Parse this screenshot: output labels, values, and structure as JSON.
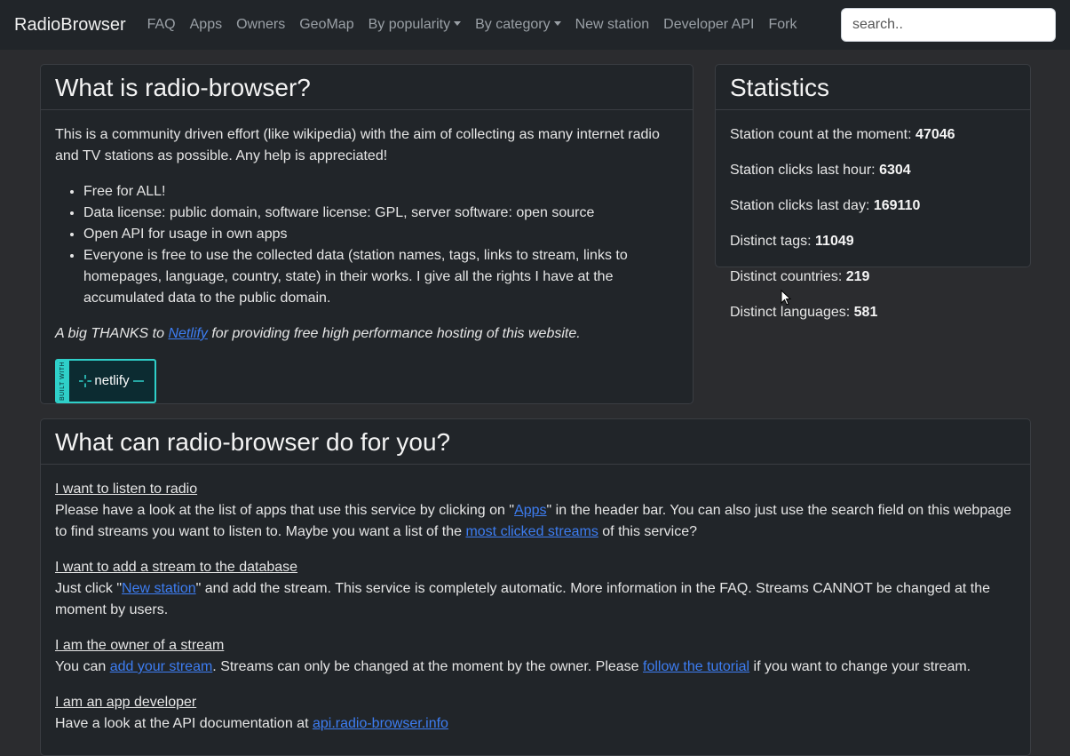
{
  "navbar": {
    "brand": "RadioBrowser",
    "items": [
      "FAQ",
      "Apps",
      "Owners",
      "GeoMap"
    ],
    "dropdowns": [
      "By popularity",
      "By category"
    ],
    "links": [
      "New station",
      "Developer API",
      "Fork"
    ],
    "search_placeholder": "search.."
  },
  "about": {
    "title": "What is radio-browser?",
    "intro": "This is a community driven effort (like wikipedia) with the aim of collecting as many internet radio and TV stations as possible. Any help is appreciated!",
    "features": [
      "Free for ALL!",
      "Data license: public domain, software license: GPL, server software: open source",
      "Open API for usage in own apps",
      "Everyone is free to use the collected data (station names, tags, links to stream, links to homepages, language, country, state) in their works. I give all the rights I have at the accumulated data to the public domain."
    ],
    "thanks_before": "A big THANKS to ",
    "thanks_link": "Netlify",
    "thanks_after": " for providing free high performance hosting of this website.",
    "badge_side": "BUILT WITH",
    "badge_text": "netlify"
  },
  "stats": {
    "title": "Statistics",
    "items": [
      {
        "label": "Station count at the moment: ",
        "value": "47046"
      },
      {
        "label": "Station clicks last hour: ",
        "value": "6304"
      },
      {
        "label": "Station clicks last day: ",
        "value": "169110"
      },
      {
        "label": "Distinct tags: ",
        "value": "11049"
      },
      {
        "label": "Distinct countries: ",
        "value": "219"
      },
      {
        "label": "Distinct languages: ",
        "value": "581"
      }
    ]
  },
  "help": {
    "title": "What can radio-browser do for you?",
    "listen": {
      "heading": "I want to listen to radio",
      "t1": "Please have a look at the list of apps that use this service by clicking on \"",
      "link1": "Apps",
      "t2": "\" in the header bar. You can also just use the search field on this webpage to find streams you want to listen to. Maybe you want a list of the ",
      "link2": "most clicked streams",
      "t3": " of this service?"
    },
    "add": {
      "heading": "I want to add a stream to the database",
      "t1": "Just click \"",
      "link1": "New station",
      "t2": "\" and add the stream. This service is completely automatic. More information in the FAQ. Streams CANNOT be changed at the moment by users."
    },
    "owner": {
      "heading": "I am the owner of a stream",
      "t1": "You can ",
      "link1": "add your stream",
      "t2": ". Streams can only be changed at the moment by the owner. Please ",
      "link2": "follow the tutorial",
      "t3": " if you want to change your stream."
    },
    "dev": {
      "heading": "I am an app developer",
      "t1": "Have a look at the API documentation at ",
      "link1": "api.radio-browser.info"
    }
  }
}
